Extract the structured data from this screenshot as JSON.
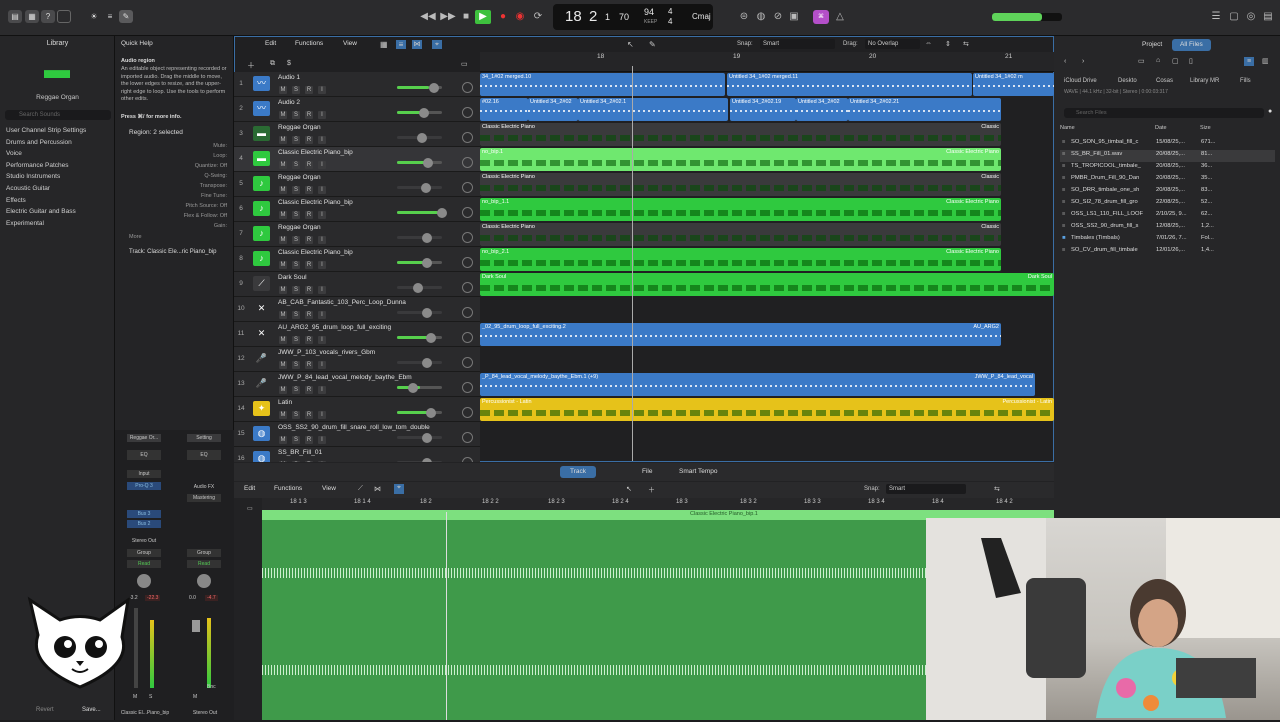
{
  "lcd": {
    "bar": "18",
    "beat": "2",
    "div": "1",
    "tick": "70",
    "tempo": "94",
    "tempo_label": "KEEP",
    "sig_top": "4",
    "sig_bottom": "4",
    "key": "Cmaj"
  },
  "library": {
    "title": "Library",
    "patch": "Reggae Organ",
    "search": "Search Sounds",
    "categories": [
      "User Channel Strip Settings",
      "Drums and Percussion",
      "Voice",
      "Performance Patches",
      "Studio Instruments",
      "Acoustic Guitar",
      "Effects",
      "Electric Guitar and Bass",
      "Experimental"
    ]
  },
  "inspector": {
    "quick_help": "Quick Help",
    "qh_title": "Audio region",
    "qh_body": "An editable object representing recorded or imported audio. Drag the middle to move, the lower edges to resize, and the upper-right edge to loop. Use the tools to perform other edits.",
    "qh_more": "Press ⌘/ for more info.",
    "region": "Region: 2 selected",
    "params": [
      "Mute:",
      "Loop:",
      "Quantize: Off",
      "Q-Swing:",
      "Transpose:",
      "Fine Tune:",
      "Pitch Source: Off",
      "Flex & Follow: Off",
      "Gain:"
    ],
    "more": "More",
    "track": "Track: Classic Ele...ric Piano_bip"
  },
  "mixer": {
    "strip1": "Reggae Or...",
    "strip2": "Setting",
    "eq": "EQ",
    "input": "Input",
    "plugin": "Pro-Q 3",
    "fx": "Audio FX",
    "mastering": "Mastering",
    "bus3": "Bus 3",
    "bus2": "Bus 2",
    "stereo_out": "Stereo Out",
    "group": "Group",
    "read": "Read",
    "vol1": "-3.2",
    "vol2": "-22.3",
    "vol3": "0.0",
    "vol4": "-4.7",
    "bnc": "Bnc",
    "m": "M",
    "s": "S",
    "name1": "Classic El...Piano_bip",
    "name2": "Stereo Out",
    "revert": "Revert",
    "save": "Save..."
  },
  "toolbar": {
    "edit": "Edit",
    "functions": "Functions",
    "view": "View",
    "snap_label": "Snap:",
    "snap": "Smart",
    "drag_label": "Drag:",
    "drag": "No Overlap"
  },
  "ruler": [
    "18",
    "19",
    "20",
    "21"
  ],
  "tracks": [
    {
      "n": "1",
      "name": "Audio 1"
    },
    {
      "n": "2",
      "name": "Audio 2"
    },
    {
      "n": "3",
      "name": "Reggae Organ"
    },
    {
      "n": "4",
      "name": "Classic Electric Piano_bip"
    },
    {
      "n": "5",
      "name": "Reggae Organ"
    },
    {
      "n": "6",
      "name": "Classic Electric Piano_bip"
    },
    {
      "n": "7",
      "name": "Reggae Organ"
    },
    {
      "n": "8",
      "name": "Classic Electric Piano_bip"
    },
    {
      "n": "9",
      "name": "Dark Soul"
    },
    {
      "n": "10",
      "name": "AB_CAB_Fantastic_103_Perc_Loop_Dunna"
    },
    {
      "n": "11",
      "name": "AU_ARG2_95_drum_loop_full_exciting"
    },
    {
      "n": "12",
      "name": "JWW_P_103_vocals_rivers_Gbm"
    },
    {
      "n": "13",
      "name": "JWW_P_84_lead_vocal_melody_baythe_Ebm"
    },
    {
      "n": "14",
      "name": "Latin"
    },
    {
      "n": "15",
      "name": "OSS_SS2_90_drum_fill_snare_roll_low_tom_double"
    },
    {
      "n": "16",
      "name": "SS_BR_Fill_01"
    }
  ],
  "regions": {
    "r1a": "34_1#02 merged.10",
    "r1b": "Untitled 34_1#02 merged.11",
    "r1c": "Untitled 34_1#02 m",
    "r2a": "#02.16",
    "r2b": "Untitled 34_2#02",
    "r2c": "Untitled 34_2#02.1",
    "r2d": "Untitled 34_2#02.19",
    "r2e": "Untitled 34_2#02",
    "r2f": "Untitled 34_2#02.21",
    "cep": "Classic Electric Piano",
    "cepb": "Classic Electric Piano",
    "cepb1": "no_bip.1",
    "cepb2": "no_bip_1.1",
    "cepb3": "no_bip_2.1",
    "classic": "Classic",
    "dark": "Dark Soul",
    "arg": "_02_95_drum_loop_full_exciting.2",
    "arg_r": "AU_ARG2",
    "jww": "_P_84_lead_vocal_melody_baythe_Ebm.1 (+9)",
    "jww_r": "JWW_P_84_lead_vocal",
    "latin": "Percussionist - Latin",
    "latin_r": "Percussionist - Latin"
  },
  "editor": {
    "tab_track": "Track",
    "tab_file": "File",
    "tab_smart": "Smart Tempo",
    "edit": "Edit",
    "functions": "Functions",
    "view": "View",
    "snap_label": "Snap:",
    "snap": "Smart",
    "ruler": [
      "18 1 3",
      "18 1 4",
      "18 2",
      "18 2 2",
      "18 2 3",
      "18 2 4",
      "18 3",
      "18 3 2",
      "18 3 3",
      "18 3 4",
      "18 4",
      "18 4 2"
    ],
    "region": "Classic Electric Piano_bip.1"
  },
  "browser": {
    "tab_project": "Project",
    "tab_all": "All Files",
    "path": [
      "iCloud Drive",
      "Deskto",
      "Cosas",
      "Library MR",
      "Fills"
    ],
    "info": "WAVE | 44.1 kHz | 32-bit | Stereo | 0:00:03:317",
    "search": "Search Files",
    "cols": [
      "Name",
      "Date",
      "Size"
    ],
    "files": [
      [
        "SO_SON_95_timbal_fill_c",
        "15/08/25,...",
        "671..."
      ],
      [
        "SS_BR_Fill_01.wav",
        "20/08/25,...",
        "81..."
      ],
      [
        "TS_TROPICOOL_timbale_",
        "20/08/25,...",
        "36..."
      ],
      [
        "PMBR_Drum_Fill_90_Dan",
        "20/08/25,...",
        "35..."
      ],
      [
        "SO_DRR_timbale_one_sh",
        "20/08/25,...",
        "83..."
      ],
      [
        "SO_SI2_78_drum_fill_gro",
        "22/08/25,...",
        "52..."
      ],
      [
        "OSS_LS1_110_FILL_LOOF",
        "2/10/25, 9...",
        "62..."
      ],
      [
        "OSS_SS2_90_drum_fill_s",
        "12/08/25,...",
        "1,2..."
      ],
      [
        "Timbales (Timbals)",
        "7/01/26, 7...",
        "Fol..."
      ],
      [
        "SO_CV_drum_fill_timbale",
        "12/01/26,...",
        "1,4..."
      ]
    ]
  }
}
